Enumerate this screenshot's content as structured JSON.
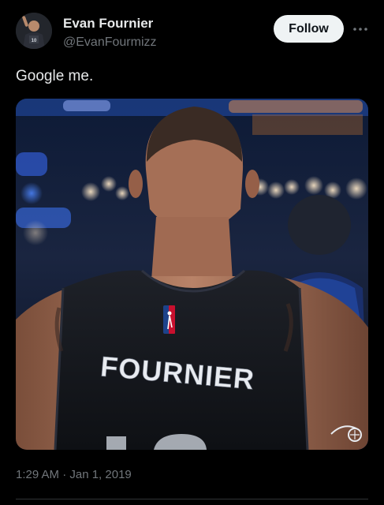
{
  "tweet": {
    "author": {
      "name": "Evan Fournier",
      "handle": "@EvanFourmizz",
      "avatar_icon": "player-avatar"
    },
    "follow_label": "Follow",
    "more_icon": "more-options-icon",
    "text": "Google me.",
    "media": {
      "jersey_name": "FOURNIER",
      "league_logo_icon": "nba-logo-icon",
      "team_logo_icon": "magic-team-logo-icon"
    },
    "timestamp": "1:29 AM · Jan 1, 2019"
  },
  "colors": {
    "background": "#000000",
    "text_primary": "#e7e9ea",
    "text_secondary": "#71767b",
    "follow_button_bg": "#eff3f4",
    "follow_button_text": "#0f1419",
    "divider": "#2f3336"
  }
}
